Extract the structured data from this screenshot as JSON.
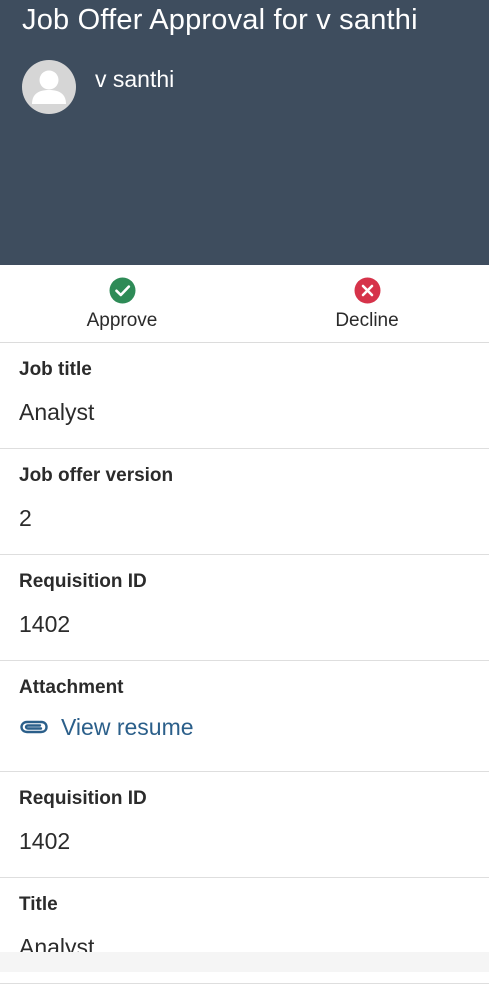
{
  "header": {
    "title": "Job Offer Approval for v santhi",
    "candidate_name": "v santhi",
    "background_color": "#3e4d5e"
  },
  "actions": [
    {
      "label": "Approve",
      "icon": "check-circle-icon",
      "color": "#2e8b57"
    },
    {
      "label": "Decline",
      "icon": "x-circle-icon",
      "color": "#d6334a"
    }
  ],
  "fields": [
    {
      "label": "Job title",
      "value": "Analyst"
    },
    {
      "label": "Job offer version",
      "value": "2"
    },
    {
      "label": "Requisition ID",
      "value": "1402"
    },
    {
      "label": "Attachment",
      "link_text": "View resume",
      "icon": "paperclip-icon",
      "link_color": "#2b5f8a"
    },
    {
      "label": "Requisition ID",
      "value": "1402"
    },
    {
      "label": "Title",
      "value": "Analyst"
    }
  ]
}
